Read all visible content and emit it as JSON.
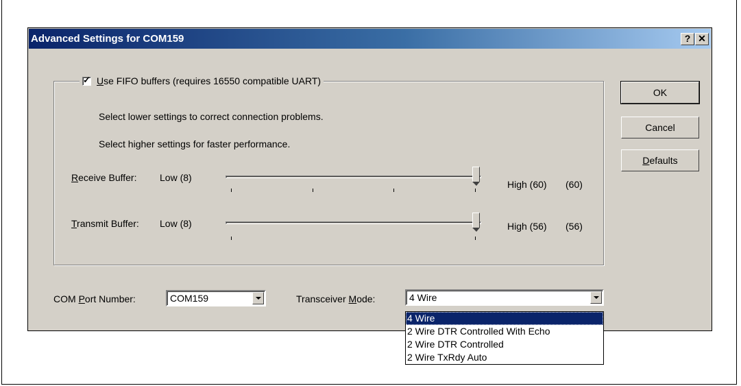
{
  "dialog": {
    "title": "Advanced Settings for COM159",
    "help_button": "?",
    "close_button": "✕"
  },
  "fifo": {
    "checked": true,
    "check_mark": "✓",
    "label_u": "U",
    "label_rest": "se FIFO buffers (requires 16550 compatible UART)",
    "hint1": "Select lower settings to correct connection problems.",
    "hint2": "Select higher settings for faster performance."
  },
  "receive": {
    "label_u": "R",
    "label_rest": "eceive Buffer:",
    "low": "Low (8)",
    "high": "High (60)",
    "value": "(60)",
    "level": 1.0
  },
  "transmit": {
    "label_u": "T",
    "label_rest": "ransmit Buffer:",
    "low": "Low (8)",
    "high": "High (56)",
    "value": "(56)",
    "level": 1.0
  },
  "buttons": {
    "ok": "OK",
    "cancel": "Cancel",
    "defaults_u": "D",
    "defaults_rest": "efaults"
  },
  "com_port": {
    "label_pre": "COM ",
    "label_u": "P",
    "label_rest": "ort Number:",
    "value": "COM159"
  },
  "transceiver": {
    "label_pre": "Transceiver ",
    "label_u": "M",
    "label_rest": "ode:",
    "value": "4 Wire",
    "options": [
      "4 Wire",
      "2 Wire DTR Controlled With Echo",
      "2 Wire DTR Controlled",
      "2 Wire TxRdy Auto"
    ],
    "selected_index": 0
  }
}
